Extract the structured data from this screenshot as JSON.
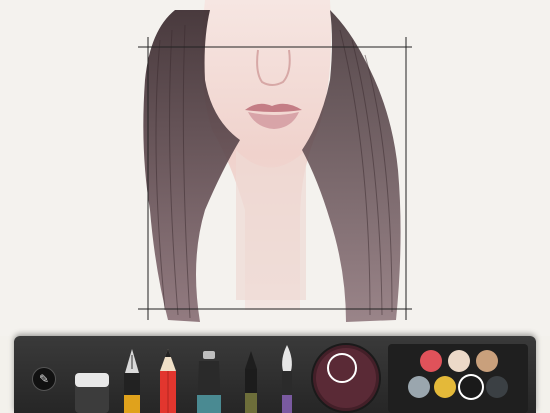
{
  "toolbar": {
    "menu_icon": "pencil-icon",
    "tools": [
      {
        "name": "eraser",
        "icon": "eraser-icon"
      },
      {
        "name": "fountain-pen",
        "icon": "fountain-pen-icon"
      },
      {
        "name": "pencil",
        "icon": "pencil-icon",
        "selected": true
      },
      {
        "name": "marker",
        "icon": "marker-icon"
      },
      {
        "name": "fine-liner",
        "icon": "fine-liner-icon"
      },
      {
        "name": "watercolor-brush",
        "icon": "brush-icon"
      }
    ],
    "current_color": "#5a2a36",
    "palette": [
      {
        "color": "#e0525a"
      },
      {
        "color": "#ecd9c8"
      },
      {
        "color": "#c9a07c"
      },
      {
        "color": "#9aa6ae"
      },
      {
        "color": "#e4b939"
      },
      {
        "color": "#1a1a1a",
        "selected": true
      },
      {
        "color": "#3b4044"
      }
    ]
  },
  "colors": {
    "toolbar_bg": "#2e2e2e",
    "canvas_bg": "#f4f2ee",
    "hair": "#4a2e33",
    "skin": "#f1d6d0",
    "lips": "#c98c92"
  }
}
